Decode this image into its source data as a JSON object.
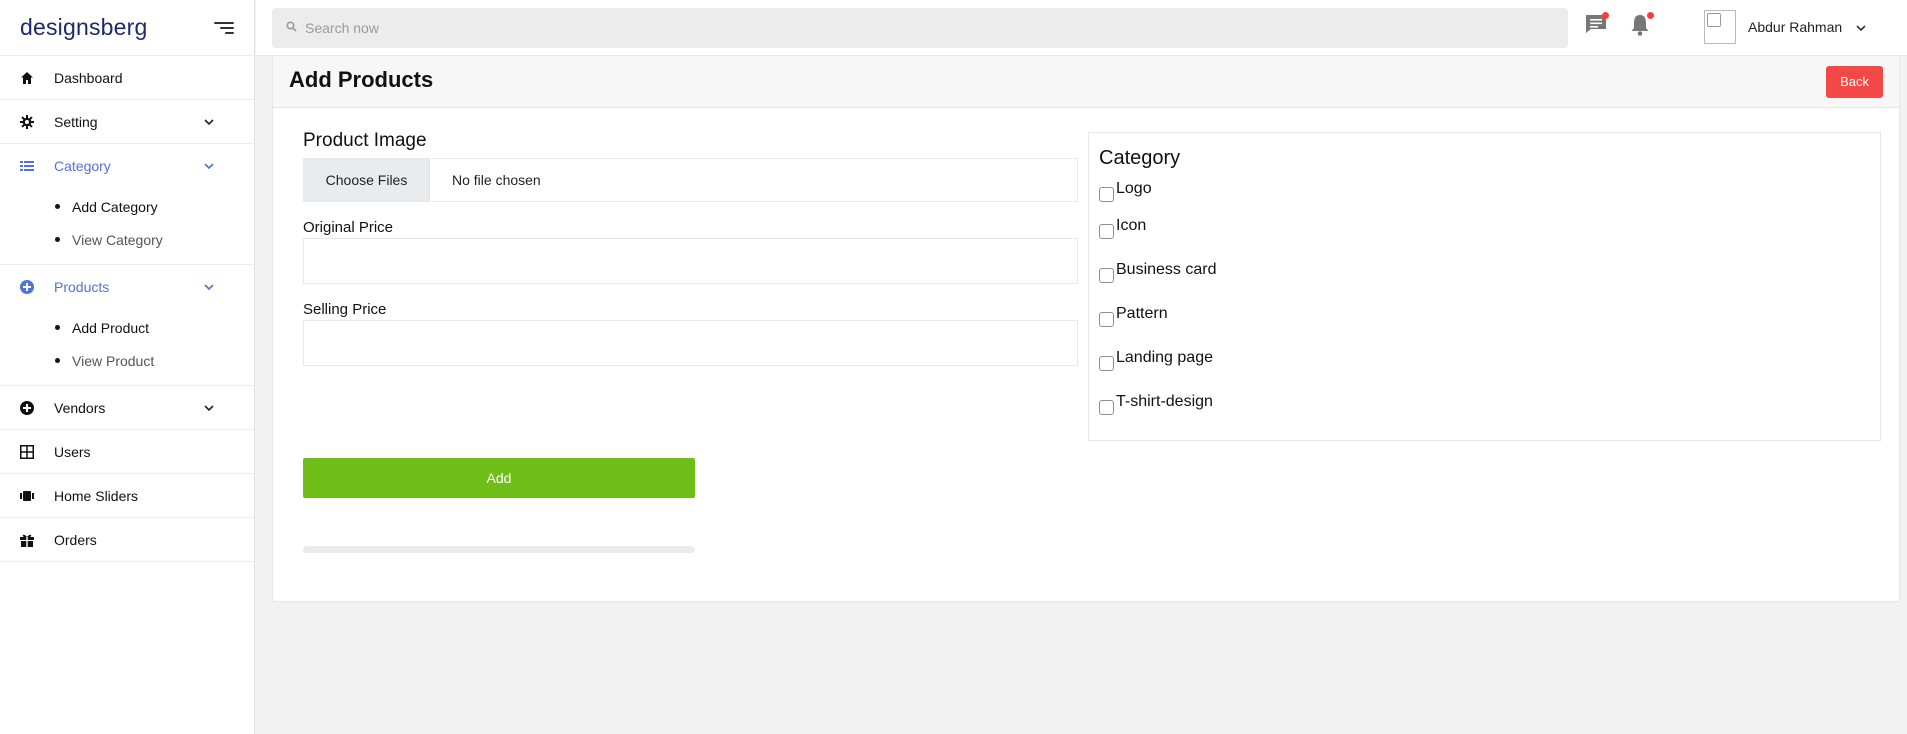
{
  "brand": "designsberg",
  "sidebar": {
    "items": [
      {
        "label": "Dashboard"
      },
      {
        "label": "Setting"
      },
      {
        "label": "Category",
        "children": [
          {
            "label": "Add Category"
          },
          {
            "label": "View Category"
          }
        ]
      },
      {
        "label": "Products",
        "children": [
          {
            "label": "Add Product"
          },
          {
            "label": "View Product"
          }
        ]
      },
      {
        "label": "Vendors"
      },
      {
        "label": "Users"
      },
      {
        "label": "Home Sliders"
      },
      {
        "label": "Orders"
      }
    ]
  },
  "topbar": {
    "search_placeholder": "Search now",
    "user_name": "Abdur Rahman"
  },
  "page": {
    "title": "Add Products",
    "back_label": "Back"
  },
  "form": {
    "image_label": "Product Image",
    "file_button": "Choose Files",
    "file_status": "No file chosen",
    "original_price_label": "Original Price",
    "original_price_value": "",
    "selling_price_label": "Selling Price",
    "selling_price_value": "",
    "submit_label": "Add",
    "upload_progress": 0
  },
  "category": {
    "title": "Category",
    "options": [
      {
        "label": "Logo",
        "checked": false
      },
      {
        "label": "Icon",
        "checked": false
      },
      {
        "label": "Business card",
        "checked": false
      },
      {
        "label": "Pattern",
        "checked": false
      },
      {
        "label": "Landing page",
        "checked": false
      },
      {
        "label": "T-shirt-design",
        "checked": false
      }
    ]
  },
  "colors": {
    "brand": "#1e2a6b",
    "accent": "#4f73d9",
    "back_button": "#f24848",
    "add_button": "#6fbe18",
    "notification_badge": "#ff3b3b"
  },
  "icons": {
    "dashboard": "home-icon",
    "setting": "gear-icon",
    "category": "list-icon",
    "products": "plus-circle-icon",
    "vendors": "plus-circle-icon",
    "users": "grid-icon",
    "home_sliders": "slider-icon",
    "orders": "gift-icon"
  }
}
